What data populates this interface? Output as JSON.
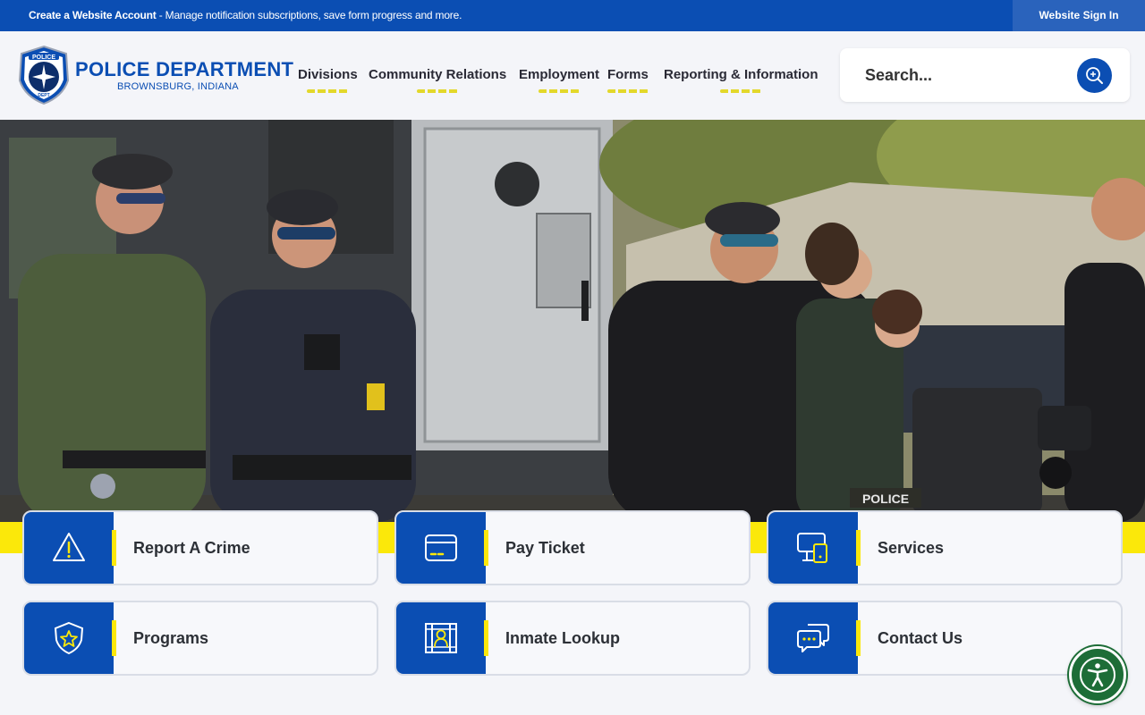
{
  "topbar": {
    "create_bold": "Create a Website Account",
    "create_rest": " - Manage notification subscriptions, save form progress and more.",
    "signin": "Website Sign In"
  },
  "brand": {
    "title": "POLICE DEPARTMENT",
    "subtitle": "BROWNSBURG, INDIANA",
    "badge_top": "POLICE",
    "badge_bottom": "DEPT"
  },
  "nav": {
    "items": [
      {
        "label": "Divisions"
      },
      {
        "label": "Community Relations"
      },
      {
        "label": "Employment"
      },
      {
        "label": "Forms"
      },
      {
        "label": "Reporting & Information"
      }
    ]
  },
  "search": {
    "placeholder": "Search...",
    "icon": "search-icon"
  },
  "hero": {
    "vest_text": "POLICE"
  },
  "colors": {
    "primary_blue": "#0b4eb3",
    "accent_yellow": "#fbe80a",
    "a11y_green": "#1d6d37"
  },
  "quick_links": [
    {
      "label": "Report A Crime",
      "icon": "warning-icon"
    },
    {
      "label": "Pay Ticket",
      "icon": "credit-card-icon"
    },
    {
      "label": "Services",
      "icon": "devices-icon"
    },
    {
      "label": "Programs",
      "icon": "shield-star-icon"
    },
    {
      "label": "Inmate Lookup",
      "icon": "jail-person-icon"
    },
    {
      "label": "Contact Us",
      "icon": "chat-bubbles-icon"
    }
  ],
  "accessibility": {
    "icon": "accessibility-icon"
  }
}
